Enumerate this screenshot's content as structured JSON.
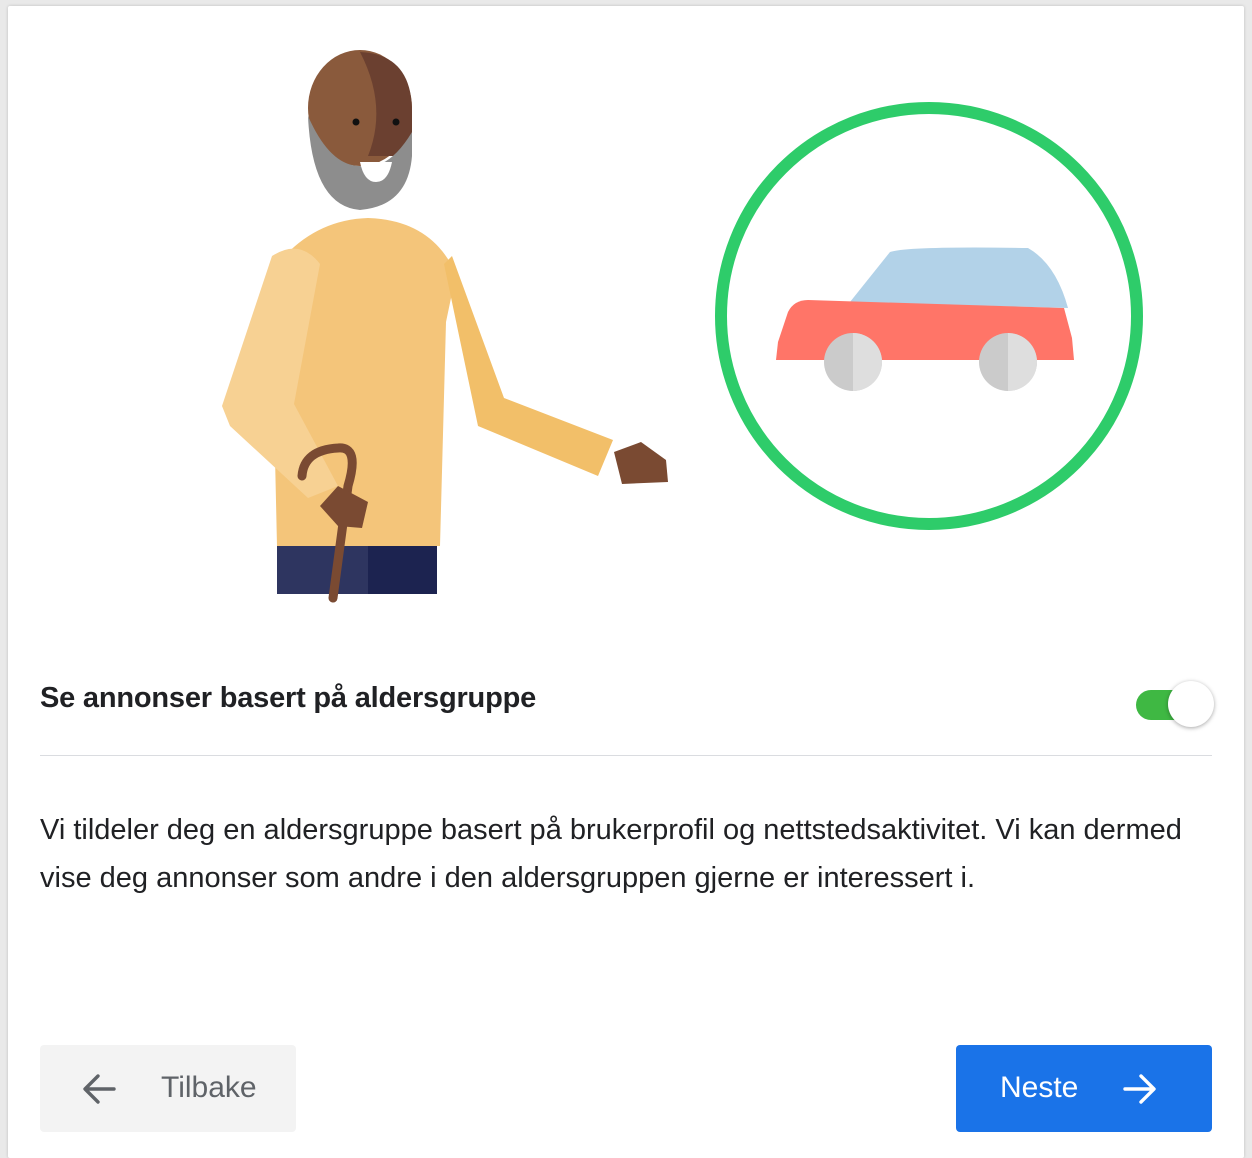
{
  "setting": {
    "title": "Se annonser basert på aldersgruppe",
    "enabled": true,
    "toggle_color": "#3fb843"
  },
  "description": "Vi tildeler deg en aldersgruppe basert på brukerprofil og nettstedsaktivitet. Vi kan dermed vise deg annonser som andre i den aldersgruppen gjerne er interessert i.",
  "buttons": {
    "back_label": "Tilbake",
    "back_icon": "arrow-left-icon",
    "next_label": "Neste",
    "next_icon": "arrow-right-icon",
    "next_color": "#1a73e8"
  },
  "illustration": {
    "person": "elderly-man-with-cane",
    "highlight_ring_color": "#2ecc6a",
    "car_color": "#ff7568"
  }
}
